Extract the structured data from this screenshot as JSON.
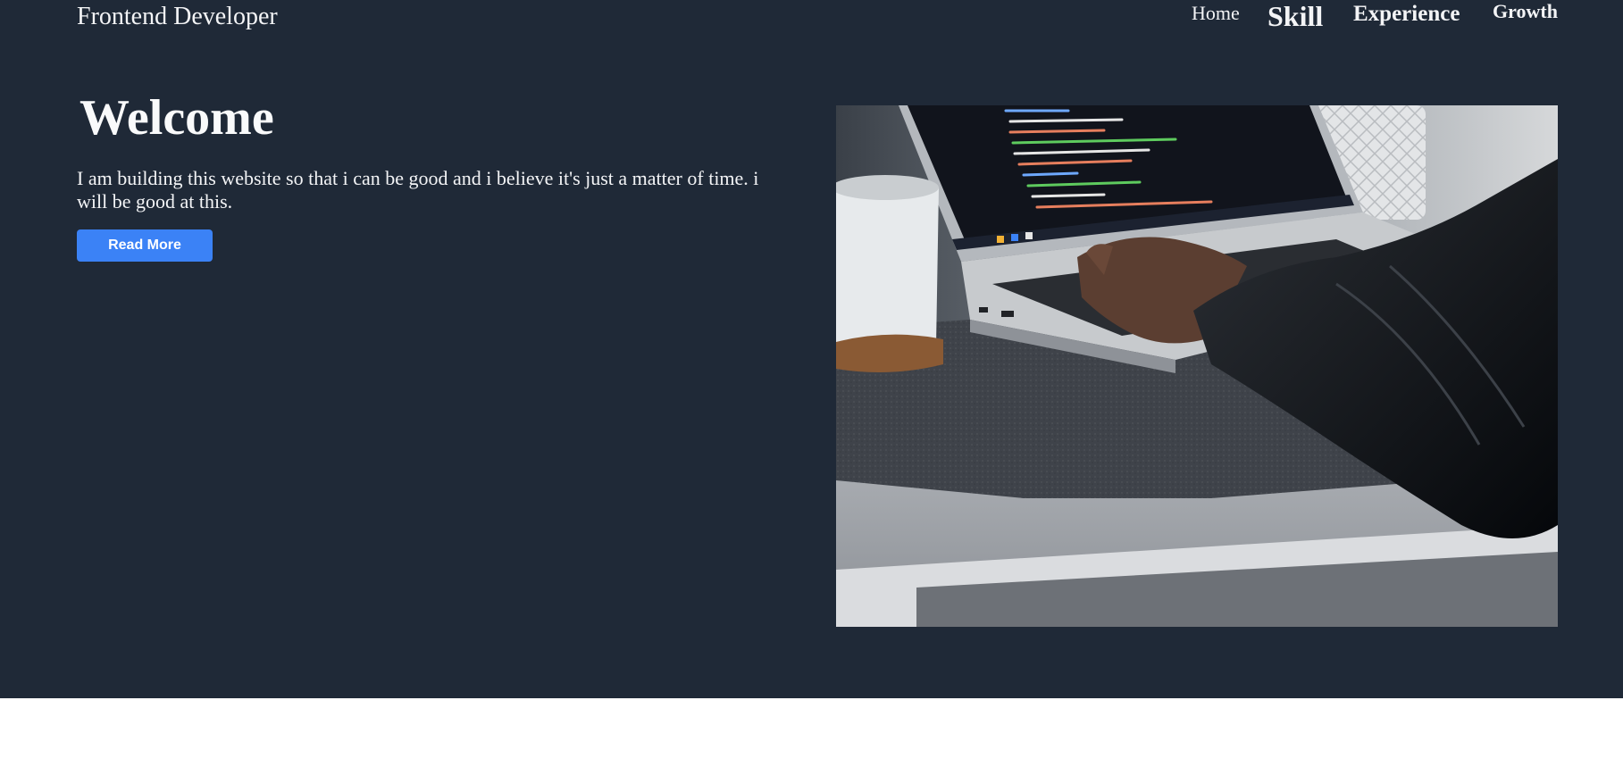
{
  "header": {
    "brand": "Frontend Developer",
    "nav": {
      "home": "Home",
      "skill": "Skill",
      "experience": "Experience",
      "growth": "Growth"
    }
  },
  "hero": {
    "heading": "Welcome",
    "intro": "I am building this website so that i can be good and i believe it's just a matter of time. i will be good at this.",
    "cta_label": "Read More",
    "image_alt": "Person typing code on a laptop beside a coffee mug"
  },
  "colors": {
    "hero_background": "#1f2937",
    "page_background": "#ffffff",
    "accent": "#3b82f6",
    "text": "#f3f4f6"
  }
}
